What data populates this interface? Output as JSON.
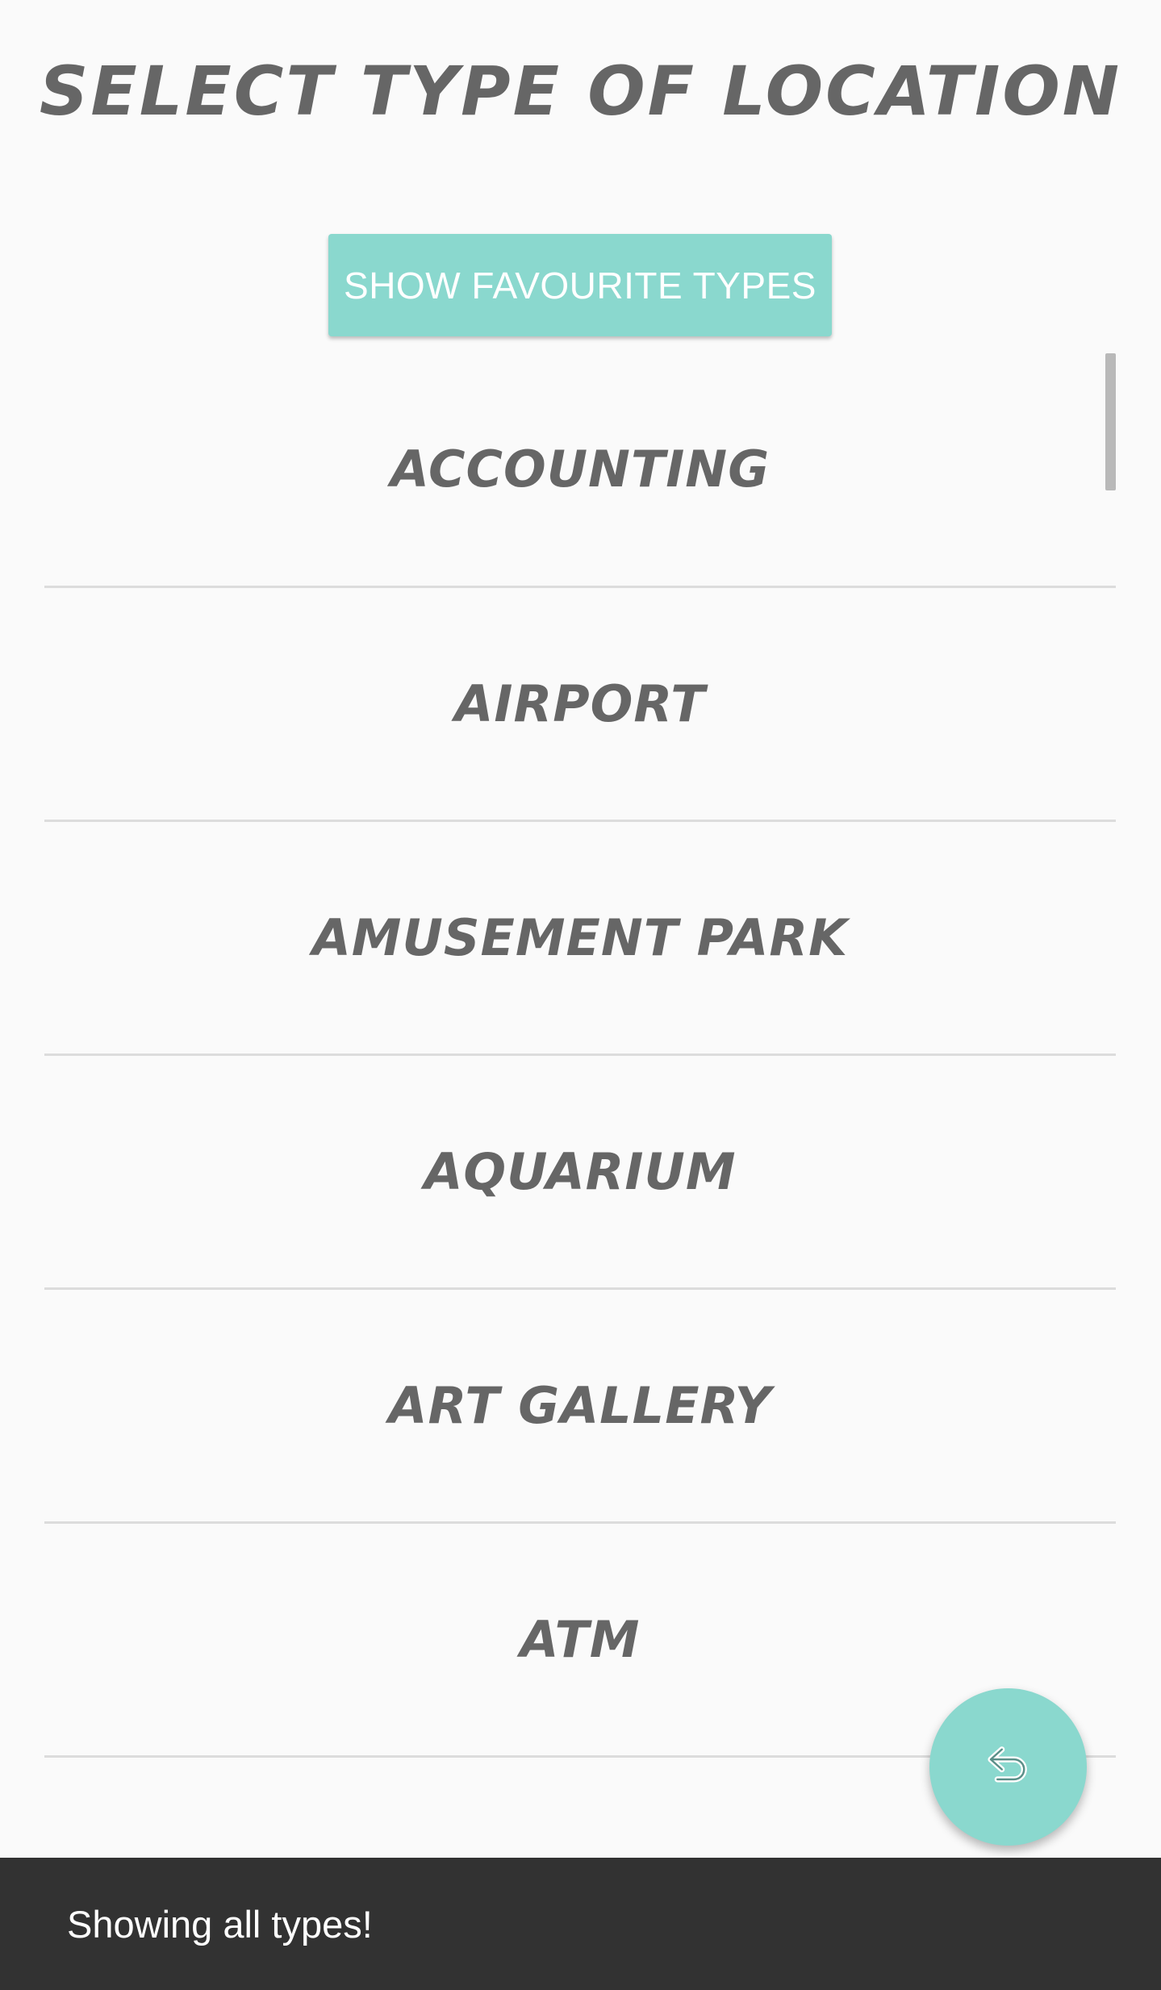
{
  "header": {
    "title": "Select type of location"
  },
  "actions": {
    "show_favourites_label": "SHOW FAVOURITE TYPES"
  },
  "types": [
    {
      "label": "Accounting"
    },
    {
      "label": "Airport"
    },
    {
      "label": "Amusement park"
    },
    {
      "label": "Aquarium"
    },
    {
      "label": "Art gallery"
    },
    {
      "label": "ATM"
    }
  ],
  "fab": {
    "icon": "undo-icon"
  },
  "snackbar": {
    "message": "Showing all types!"
  },
  "colors": {
    "accent": "#8ad8ce",
    "text": "#666666",
    "snackbar_bg": "#323232",
    "background": "#fafafa"
  }
}
